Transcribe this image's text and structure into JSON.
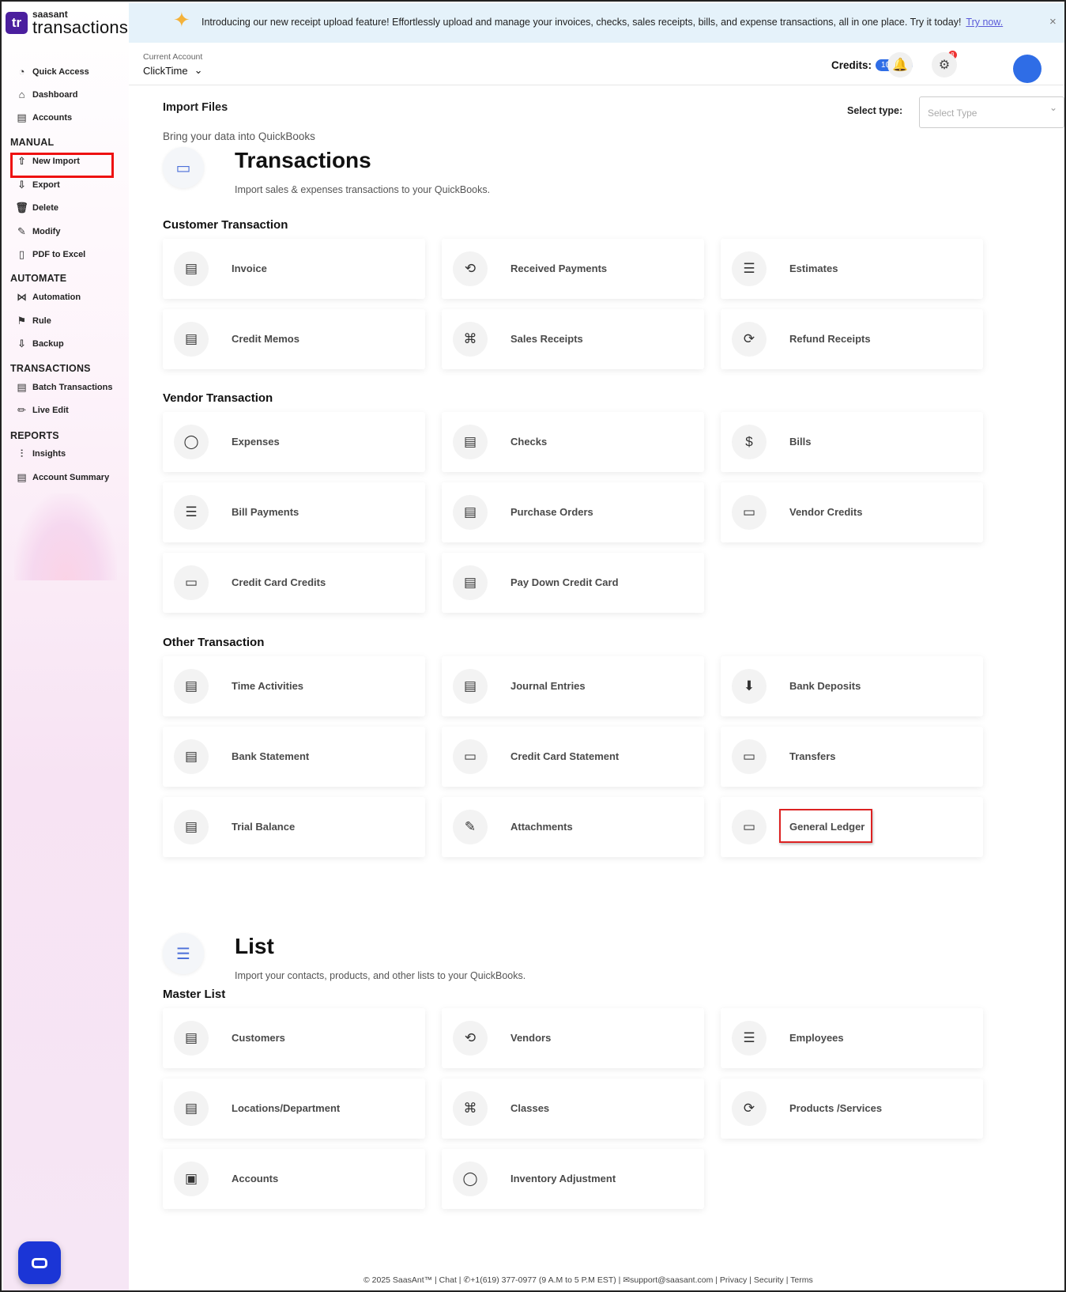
{
  "app": {
    "logo_mark": "tr",
    "logo_sub": "saasant",
    "logo_main": "transactions"
  },
  "banner": {
    "text": "Introducing our new receipt upload feature! Effortlessly upload and manage your invoices, checks, sales receipts, bills, and expense transactions, all in one place. Try it today!",
    "link": "Try now.",
    "close": "×"
  },
  "sidebar": {
    "top_items": [
      {
        "label": "Quick Access",
        "icon": "speedometer-icon"
      },
      {
        "label": "Dashboard",
        "icon": "home-icon"
      },
      {
        "label": "Accounts",
        "icon": "clipboard-icon"
      }
    ],
    "groups": [
      {
        "title": "MANUAL",
        "items": [
          {
            "label": "New Import",
            "icon": "cloud-upload-icon"
          },
          {
            "label": "Export",
            "icon": "cloud-download-icon"
          },
          {
            "label": "Delete",
            "icon": "trash-icon"
          },
          {
            "label": "Modify",
            "icon": "edit-icon"
          },
          {
            "label": "PDF to Excel",
            "icon": "pdf-icon"
          }
        ]
      },
      {
        "title": "AUTOMATE",
        "items": [
          {
            "label": "Automation",
            "icon": "share-icon"
          },
          {
            "label": "Rule",
            "icon": "rule-icon"
          },
          {
            "label": "Backup",
            "icon": "backup-icon"
          }
        ]
      },
      {
        "title": "TRANSACTIONS",
        "items": [
          {
            "label": "Batch Transactions",
            "icon": "document-icon"
          },
          {
            "label": "Live Edit",
            "icon": "pencil-icon"
          }
        ]
      },
      {
        "title": "REPORTS",
        "items": [
          {
            "label": "Insights",
            "icon": "sliders-icon"
          },
          {
            "label": "Account Summary",
            "icon": "clipboard-icon"
          }
        ]
      }
    ]
  },
  "header": {
    "account_label": "Current Account",
    "account_value": "ClickTime",
    "credits_label": "Credits:",
    "credits_value": "100779",
    "notif_badge": "9"
  },
  "page": {
    "title": "Import Files",
    "subtitle": "Bring your data into QuickBooks",
    "select_label": "Select type:",
    "select_placeholder": "Select Type"
  },
  "transactions": {
    "title": "Transactions",
    "desc": "Import sales & expenses transactions to your QuickBooks.",
    "groups": [
      {
        "title": "Customer Transaction",
        "cards": [
          "Invoice",
          "Received Payments",
          "Estimates",
          "Credit Memos",
          "Sales Receipts",
          "Refund Receipts"
        ]
      },
      {
        "title": "Vendor Transaction",
        "cards": [
          "Expenses",
          "Checks",
          "Bills",
          "Bill Payments",
          "Purchase Orders",
          "Vendor Credits",
          "Credit Card Credits",
          "Pay Down Credit Card"
        ]
      },
      {
        "title": "Other Transaction",
        "cards": [
          "Time Activities",
          "Journal Entries",
          "Bank Deposits",
          "Bank Statement",
          "Credit Card Statement",
          "Transfers",
          "Trial Balance",
          "Attachments",
          "General Ledger"
        ]
      }
    ]
  },
  "list": {
    "title": "List",
    "desc": "Import your contacts, products, and other lists to your QuickBooks.",
    "groups": [
      {
        "title": "Master List",
        "cards": [
          "Customers",
          "Vendors",
          "Employees",
          "Locations/Department",
          "Classes",
          "Products /Services",
          "Accounts",
          "Inventory Adjustment"
        ]
      }
    ]
  },
  "footer": {
    "text": "© 2025 SaasAnt™  | Chat  |  ✆+1(619) 377-0977 (9 A.M to 5 P.M EST)  |  ✉support@saasant.com  | Privacy  | Security  | Terms"
  }
}
